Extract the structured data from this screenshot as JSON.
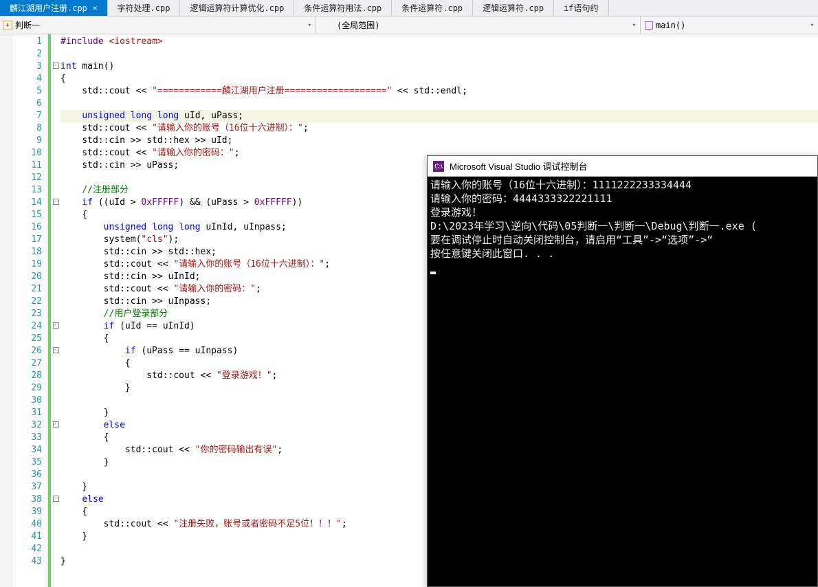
{
  "tabs": [
    {
      "label": "麟江湖用户注册.cpp",
      "active": true,
      "closable": true
    },
    {
      "label": "字符处理.cpp"
    },
    {
      "label": "逻辑运算符计算优化.cpp"
    },
    {
      "label": "条件运算符用法.cpp"
    },
    {
      "label": "条件运算符.cpp"
    },
    {
      "label": "逻辑运算符.cpp"
    },
    {
      "label": "if语句约"
    }
  ],
  "nav": {
    "left": "判断一",
    "mid": "(全局范围)",
    "right": "main()"
  },
  "lines": [
    "1",
    "2",
    "3",
    "4",
    "5",
    "6",
    "7",
    "8",
    "9",
    "10",
    "11",
    "12",
    "13",
    "14",
    "15",
    "16",
    "17",
    "18",
    "19",
    "20",
    "21",
    "22",
    "23",
    "24",
    "25",
    "26",
    "27",
    "28",
    "29",
    "30",
    "31",
    "32",
    "33",
    "34",
    "35",
    "36",
    "37",
    "38",
    "39",
    "40",
    "41",
    "42",
    "43"
  ],
  "code": {
    "l1a": "#include ",
    "l1b": "<iostream>",
    "l3a": "int",
    "l3b": " main()",
    "l4": "{",
    "l5a": "    std::cout << ",
    "l5b": "\"============麟江湖用户注册===================\"",
    "l5c": " << std::endl;",
    "l7a": "    ",
    "l7b": "unsigned",
    "l7c": " ",
    "l7d": "long",
    "l7e": " ",
    "l7f": "long",
    "l7g": " uId, uPass;",
    "l8a": "    std::cout << ",
    "l8b": "\"请输入你的账号（16位十六进制）：\"",
    "l8c": ";",
    "l9a": "    std::cin >> std::hex >> uId;",
    "l10a": "    std::cout << ",
    "l10b": "\"请输入你的密码：\"",
    "l10c": ";",
    "l11": "    std::cin >> uPass;",
    "l13a": "    ",
    "l13b": "//注册部分",
    "l14a": "    ",
    "l14b": "if",
    "l14c": " ((uId > ",
    "l14d": "0xFFFFF",
    "l14e": ") && (uPass > ",
    "l14f": "0xFFFFF",
    "l14g": "))",
    "l15": "    {",
    "l16a": "        ",
    "l16b": "unsigned",
    "l16c": " ",
    "l16d": "long",
    "l16e": " ",
    "l16f": "long",
    "l16g": " uInId, uInpass;",
    "l17a": "        system(",
    "l17b": "\"cls\"",
    "l17c": ");",
    "l18": "        std::cin >> std::hex;",
    "l19a": "        std::cout << ",
    "l19b": "\"请输入你的账号（16位十六进制）：\"",
    "l19c": ";",
    "l20": "        std::cin >> uInId;",
    "l21a": "        std::cout << ",
    "l21b": "\"请输入你的密码：\"",
    "l21c": ";",
    "l22": "        std::cin >> uInpass;",
    "l23a": "        ",
    "l23b": "//用户登录部分",
    "l24a": "        ",
    "l24b": "if",
    "l24c": " (uId == uInId)",
    "l25": "        {",
    "l26a": "            ",
    "l26b": "if",
    "l26c": " (uPass == uInpass)",
    "l27": "            {",
    "l28a": "                std::cout << ",
    "l28b": "\"登录游戏！\"",
    "l28c": ";",
    "l29": "            }",
    "l31": "        }",
    "l32a": "        ",
    "l32b": "else",
    "l33": "        {",
    "l34a": "            std::cout << ",
    "l34b": "\"你的密码输出有误\"",
    "l34c": ";",
    "l35": "        }",
    "l37": "    }",
    "l38a": "    ",
    "l38b": "else",
    "l39": "    {",
    "l40a": "        std::cout << ",
    "l40b": "\"注册失败，账号或者密码不足5位！！！\"",
    "l40c": ";",
    "l41": "    }",
    "l43": "}"
  },
  "console": {
    "title": "Microsoft Visual Studio 调试控制台",
    "l1": "请输入你的账号（16位十六进制）：1111222233334444",
    "l2": "请输入你的密码：4444333322221111",
    "l3": "登录游戏！",
    "l4": "D:\\2023年学习\\逆向\\代码\\05判断一\\判断一\\Debug\\判断一.exe (",
    "l5": "要在调试停止时自动关闭控制台，请启用“工具”->“选项”->“",
    "l6": "按任意键关闭此窗口. . ."
  }
}
